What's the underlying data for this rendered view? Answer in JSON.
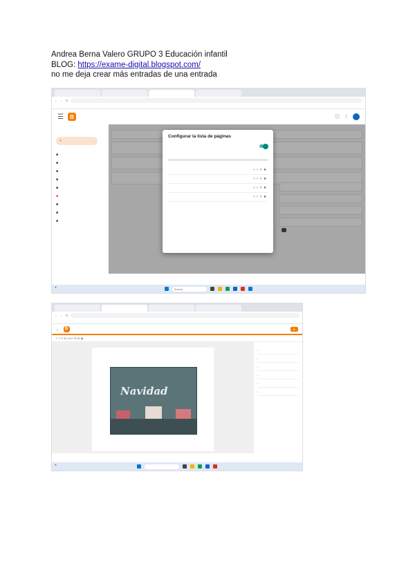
{
  "header": {
    "line1": "Andrea Berna Valero GRUPO 3 Educación infantil",
    "blog_label": "BLOG: ",
    "blog_url": "https://exame-digital.blogspot.com/",
    "line3": "no me deja crear más entradas de una entrada"
  },
  "shot1": {
    "dialog_title": "Configurar la lista de páginas",
    "search_placeholder": "Buscar"
  },
  "shot2": {
    "image_text": "Navidad"
  }
}
